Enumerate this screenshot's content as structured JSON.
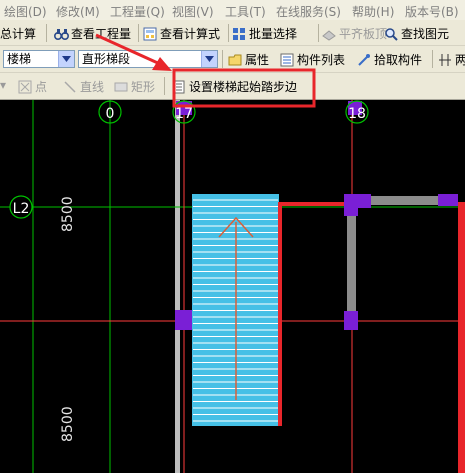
{
  "menubar": {
    "items": [
      "绘图(D)",
      "修改(M)",
      "工程量(Q)",
      "视图(V)",
      "工具(T)",
      "在线服务(S)",
      "帮助(H)",
      "版本号(B)"
    ]
  },
  "toolbar1": {
    "summary_calc": "总计算",
    "view_quantity": "查看工程量",
    "view_formula": "查看计算式",
    "batch_select": "批量选择",
    "flatten_slab": "平齐板顶",
    "find_element": "查找图元"
  },
  "toolbar2": {
    "element_type_value": "楼梯",
    "element_subtype_value": "直形梯段",
    "properties": "属性",
    "element_list": "构件列表",
    "pick_element": "拾取构件",
    "trailing_label": "两"
  },
  "toolbar3": {
    "point": "点",
    "line": "直线",
    "rectangle": "矩形",
    "set_start_step_edge": "设置楼梯起始踏步边"
  },
  "canvas": {
    "axis_labels": [
      "0",
      "17",
      "18",
      "L2"
    ],
    "dimensions": [
      "8500",
      "8500"
    ]
  },
  "colors": {
    "canvas_bg": "#000000",
    "grid_green": "#00c000",
    "grid_red": "#ff3b3b",
    "column_purple": "#7a1fd6",
    "stair_fill": "#45c0e6",
    "highlight_red": "#e8262b"
  }
}
